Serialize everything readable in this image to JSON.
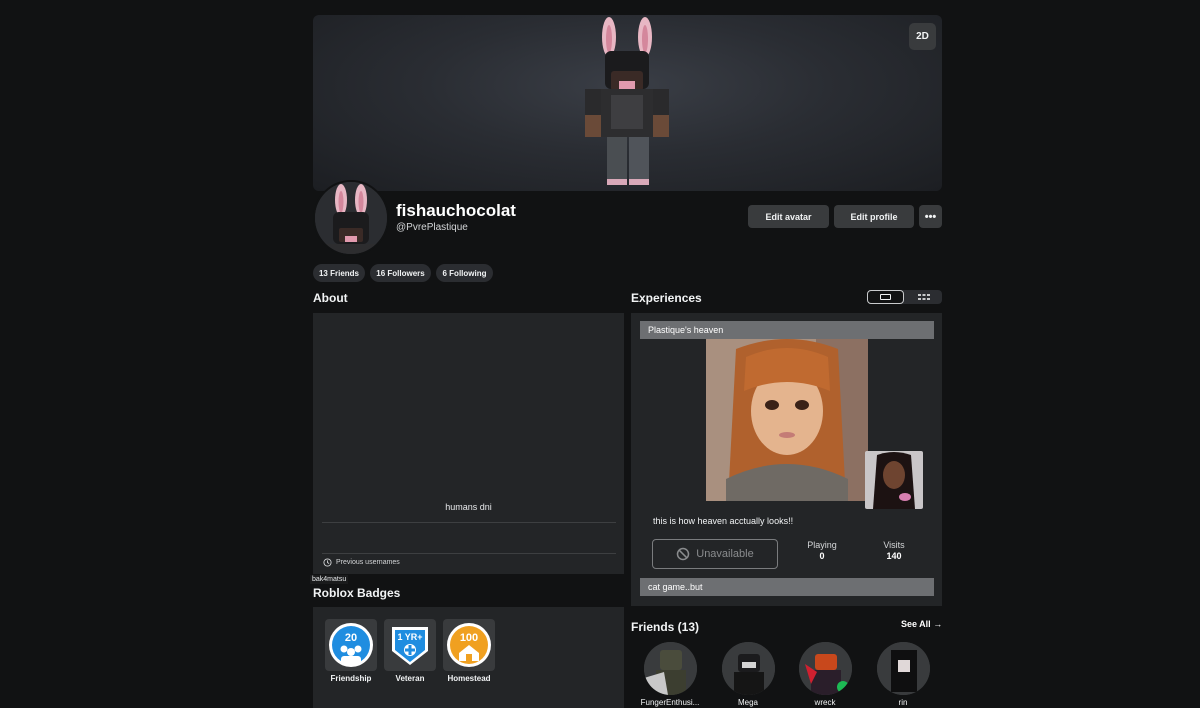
{
  "banner": {
    "view_toggle_label": "2D"
  },
  "profile": {
    "display_name": "fishauchocolat",
    "username": "@PvrePlastique",
    "edit_avatar_label": "Edit avatar",
    "edit_profile_label": "Edit profile",
    "more_label": "•••",
    "friends_pill": "13 Friends",
    "followers_pill": "16 Followers",
    "following_pill": "6 Following"
  },
  "about": {
    "title": "About",
    "text": "humans dni",
    "previous_usernames_label": "Previous usernames",
    "tooltip": "bak4matsu"
  },
  "badges": {
    "title": "Roblox Badges",
    "items": [
      {
        "label": "Friendship",
        "icon_text": "20",
        "color": "#1f8de0"
      },
      {
        "label": "Veteran",
        "icon_text": "1 YR+",
        "color": "#1f8de0"
      },
      {
        "label": "Homestead",
        "icon_text": "100",
        "color": "#f0a020"
      }
    ]
  },
  "experiences": {
    "title": "Experiences",
    "items": [
      {
        "name": "Plastique's heaven"
      },
      {
        "name": "cat game..but"
      }
    ],
    "description": "this is how heaven acctually looks!!",
    "unavailable_label": "Unavailable",
    "playing_label": "Playing",
    "playing_value": "0",
    "visits_label": "Visits",
    "visits_value": "140"
  },
  "friends": {
    "title": "Friends (13)",
    "see_all_label": "See All",
    "items": [
      {
        "name": "FungerEnthusi..."
      },
      {
        "name": "Mega"
      },
      {
        "name": "wreck"
      },
      {
        "name": "rin"
      }
    ]
  },
  "colors": {
    "background": "#111213",
    "panel": "#232527",
    "button": "#393b3d",
    "experience_header": "#6d6f72"
  }
}
